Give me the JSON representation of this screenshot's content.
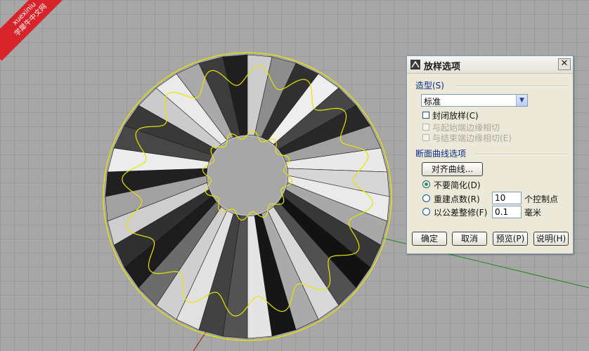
{
  "watermark": {
    "line1": "xuexiniu",
    "line2": "学犀牛中文网"
  },
  "dialog": {
    "title": "放样选项",
    "close_label": "✕",
    "shape_group": {
      "label": "造型(S)"
    },
    "style_select": {
      "value": "标准"
    },
    "closed_loft": {
      "label": "封闭放样(C)",
      "checked": false
    },
    "start_tangent": {
      "label": "与起始端边缘相切",
      "checked": false
    },
    "end_tangent": {
      "label": "与结束端边缘相切(E)",
      "checked": false
    },
    "section_group": {
      "label": "断面曲线选项"
    },
    "align_button": {
      "label": "对齐曲线..."
    },
    "options": [
      {
        "label": "不要简化(D)",
        "selected": true
      },
      {
        "label": "重建点数(R)",
        "selected": false
      },
      {
        "label": "以公差整修(F)",
        "selected": false
      }
    ],
    "rebuild_count": {
      "value": "10",
      "unit": "个控制点"
    },
    "refit_tolerance": {
      "value": "0.1",
      "unit": "毫米"
    },
    "buttons": {
      "ok": "确定",
      "cancel": "取消",
      "preview": "预览(P)",
      "help": "说明(H)"
    }
  }
}
